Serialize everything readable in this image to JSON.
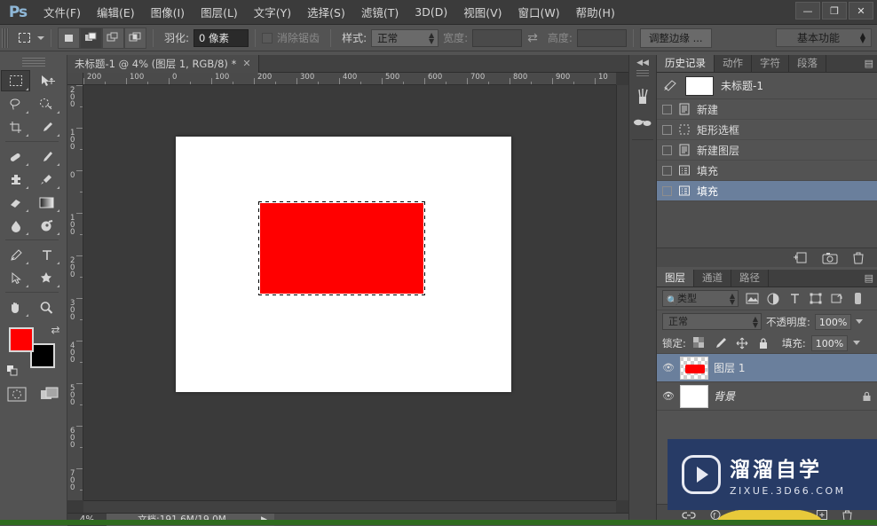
{
  "app": {
    "logo": "Ps",
    "menus": [
      {
        "label": "文件(F)"
      },
      {
        "label": "编辑(E)"
      },
      {
        "label": "图像(I)"
      },
      {
        "label": "图层(L)"
      },
      {
        "label": "文字(Y)"
      },
      {
        "label": "选择(S)"
      },
      {
        "label": "滤镜(T)"
      },
      {
        "label": "3D(D)"
      },
      {
        "label": "视图(V)"
      },
      {
        "label": "窗口(W)"
      },
      {
        "label": "帮助(H)"
      }
    ],
    "window_buttons": {
      "minimize": "—",
      "maximize": "❐",
      "close": "✕"
    }
  },
  "options_bar": {
    "tool_icon": "rectangular-marquee-icon",
    "selection_modes": [
      "new-selection",
      "add-to-selection",
      "subtract-from-selection",
      "intersect-selection"
    ],
    "active_selection_mode_index": 1,
    "feather_label": "羽化:",
    "feather_value": "0 像素",
    "antialias_label": "消除锯齿",
    "antialias_checked": false,
    "style_label": "样式:",
    "style_value": "正常",
    "width_label": "宽度:",
    "width_value": "",
    "height_label": "高度:",
    "height_value": "",
    "swap_icon": "swap-arrows-icon",
    "refine_edge_label": "调整边缘 ...",
    "workspace_value": "基本功能"
  },
  "toolbox": {
    "tools": [
      {
        "name": "rectangular-marquee",
        "selected": true
      },
      {
        "name": "move"
      },
      {
        "name": "lasso"
      },
      {
        "name": "quick-selection"
      },
      {
        "name": "crop"
      },
      {
        "name": "eyedropper"
      },
      {
        "name": "healing-brush"
      },
      {
        "name": "brush"
      },
      {
        "name": "clone-stamp"
      },
      {
        "name": "history-brush"
      },
      {
        "name": "eraser"
      },
      {
        "name": "gradient"
      },
      {
        "name": "blur"
      },
      {
        "name": "dodge"
      },
      {
        "name": "pen"
      },
      {
        "name": "horizontal-type"
      },
      {
        "name": "path-selection"
      },
      {
        "name": "custom-shape"
      },
      {
        "name": "hand"
      },
      {
        "name": "zoom"
      }
    ],
    "foreground_color": "#FF0000",
    "background_color": "#000000",
    "quick_mask": "quick-mask-icon",
    "screen_mode": "screen-mode-icon"
  },
  "document": {
    "tab_title": "未标题-1 @ 4% (图层 1, RGB/8) *",
    "close_glyph": "✕",
    "ruler_h_labels": [
      "200",
      "100",
      "0",
      "100",
      "200",
      "300",
      "400",
      "500",
      "600",
      "700",
      "800",
      "900",
      "10"
    ],
    "ruler_v_labels": [
      "200",
      "100",
      "0",
      "100",
      "200",
      "300",
      "400",
      "500",
      "600",
      "700"
    ],
    "selection_color": "#FF0000",
    "canvas_background": "#FFFFFF"
  },
  "status_bar": {
    "zoom": "4%",
    "doc_info": "文档:191.6M/19.0M",
    "expand_glyph": "▶"
  },
  "dock_strip": {
    "collapse_glyph": "◀◀",
    "buttons": [
      {
        "name": "brushes-panel-icon"
      },
      {
        "name": "clone-source-panel-icon"
      }
    ]
  },
  "history_panel": {
    "tabs": [
      {
        "label": "历史记录",
        "active": true
      },
      {
        "label": "动作",
        "active": false
      },
      {
        "label": "字符",
        "active": false
      },
      {
        "label": "段落",
        "active": false
      }
    ],
    "menu_glyph": "▤",
    "snapshot": {
      "name": "未标题-1",
      "icon": "snapshot-brush-icon"
    },
    "states": [
      {
        "label": "新建",
        "icon": "new-doc-icon",
        "selected": false
      },
      {
        "label": "矩形选框",
        "icon": "marquee-icon",
        "selected": false
      },
      {
        "label": "新建图层",
        "icon": "new-layer-icon",
        "selected": false
      },
      {
        "label": "填充",
        "icon": "fill-icon",
        "selected": false
      },
      {
        "label": "填充",
        "icon": "fill-icon",
        "selected": true
      }
    ],
    "footer_buttons": [
      {
        "name": "new-document-from-state-icon"
      },
      {
        "name": "new-snapshot-icon"
      },
      {
        "name": "delete-state-icon"
      }
    ]
  },
  "layers_panel": {
    "tabs": [
      {
        "label": "图层",
        "active": true
      },
      {
        "label": "通道",
        "active": false
      },
      {
        "label": "路径",
        "active": false
      }
    ],
    "menu_glyph": "▤",
    "filter_label": "类型",
    "filter_icons": [
      "pixel-filter-icon",
      "adjustment-filter-icon",
      "type-filter-icon",
      "shape-filter-icon",
      "smart-object-filter-icon"
    ],
    "filter_toggle": "filter-toggle-icon",
    "blend_mode": "正常",
    "opacity_label": "不透明度:",
    "opacity_value": "100%",
    "lock_label": "锁定:",
    "lock_icons": [
      "lock-transparent-icon",
      "lock-image-icon",
      "lock-position-icon",
      "lock-all-icon"
    ],
    "fill_label": "填充:",
    "fill_value": "100%",
    "layers": [
      {
        "name": "图层 1",
        "visible": true,
        "selected": true,
        "locked": false,
        "thumb": "red-shape"
      },
      {
        "name": "背景",
        "visible": true,
        "selected": false,
        "locked": true,
        "thumb": "white"
      }
    ],
    "footer_buttons": [
      {
        "name": "link-layers-icon"
      },
      {
        "name": "layer-style-icon"
      },
      {
        "name": "layer-mask-icon"
      },
      {
        "name": "adjustment-layer-icon"
      },
      {
        "name": "new-group-icon"
      },
      {
        "name": "new-layer-icon"
      },
      {
        "name": "delete-layer-icon"
      }
    ]
  },
  "watermark": {
    "title": "溜溜自学",
    "url": "ZIXUE.3D66.COM",
    "logo": "play-button-icon",
    "background": "#273B66"
  }
}
